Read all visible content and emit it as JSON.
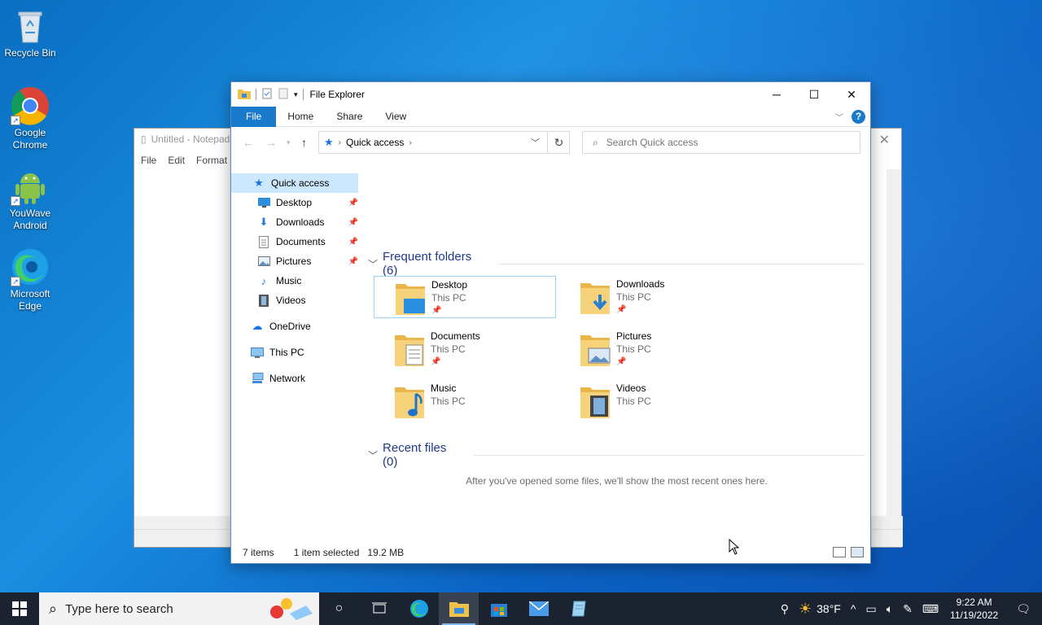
{
  "desktop": {
    "icons": [
      {
        "label": "Recycle Bin"
      },
      {
        "label": "Google Chrome"
      },
      {
        "label": "YouWave Android"
      },
      {
        "label": "Microsoft Edge"
      }
    ]
  },
  "notepad": {
    "title": "Untitled - Notepad",
    "menu": [
      "File",
      "Edit",
      "Format"
    ]
  },
  "explorer": {
    "title": "File Explorer",
    "ribbon_tabs": [
      "File",
      "Home",
      "Share",
      "View"
    ],
    "address": {
      "crumb": "Quick access"
    },
    "search": {
      "placeholder": "Search Quick access"
    },
    "nav": {
      "quick_access": "Quick access",
      "pinned": [
        {
          "label": "Desktop",
          "icon": "desktop-icon",
          "pinned": true
        },
        {
          "label": "Downloads",
          "icon": "downloads-icon",
          "pinned": true
        },
        {
          "label": "Documents",
          "icon": "documents-icon",
          "pinned": true
        },
        {
          "label": "Pictures",
          "icon": "pictures-icon",
          "pinned": true
        },
        {
          "label": "Music",
          "icon": "music-icon",
          "pinned": false
        },
        {
          "label": "Videos",
          "icon": "videos-icon",
          "pinned": false
        }
      ],
      "onedrive": "OneDrive",
      "this_pc": "This PC",
      "network": "Network"
    },
    "frequent": {
      "header": "Frequent folders (6)",
      "folders": [
        {
          "name": "Desktop",
          "location": "This PC",
          "pinned": true
        },
        {
          "name": "Downloads",
          "location": "This PC",
          "pinned": true
        },
        {
          "name": "Documents",
          "location": "This PC",
          "pinned": true
        },
        {
          "name": "Pictures",
          "location": "This PC",
          "pinned": true
        },
        {
          "name": "Music",
          "location": "This PC",
          "pinned": false
        },
        {
          "name": "Videos",
          "location": "This PC",
          "pinned": false
        }
      ]
    },
    "recent": {
      "header": "Recent files (0)",
      "empty_message": "After you've opened some files, we'll show the most recent ones here."
    },
    "status": {
      "items": "7 items",
      "selected": "1 item selected",
      "size": "19.2 MB"
    }
  },
  "taskbar": {
    "search_placeholder": "Type here to search",
    "weather": "38°F",
    "time": "9:22 AM",
    "date": "11/19/2022"
  },
  "colors": {
    "accent": "#1979ca",
    "selection": "#cce8ff",
    "header_blue": "#1e3a8a"
  }
}
